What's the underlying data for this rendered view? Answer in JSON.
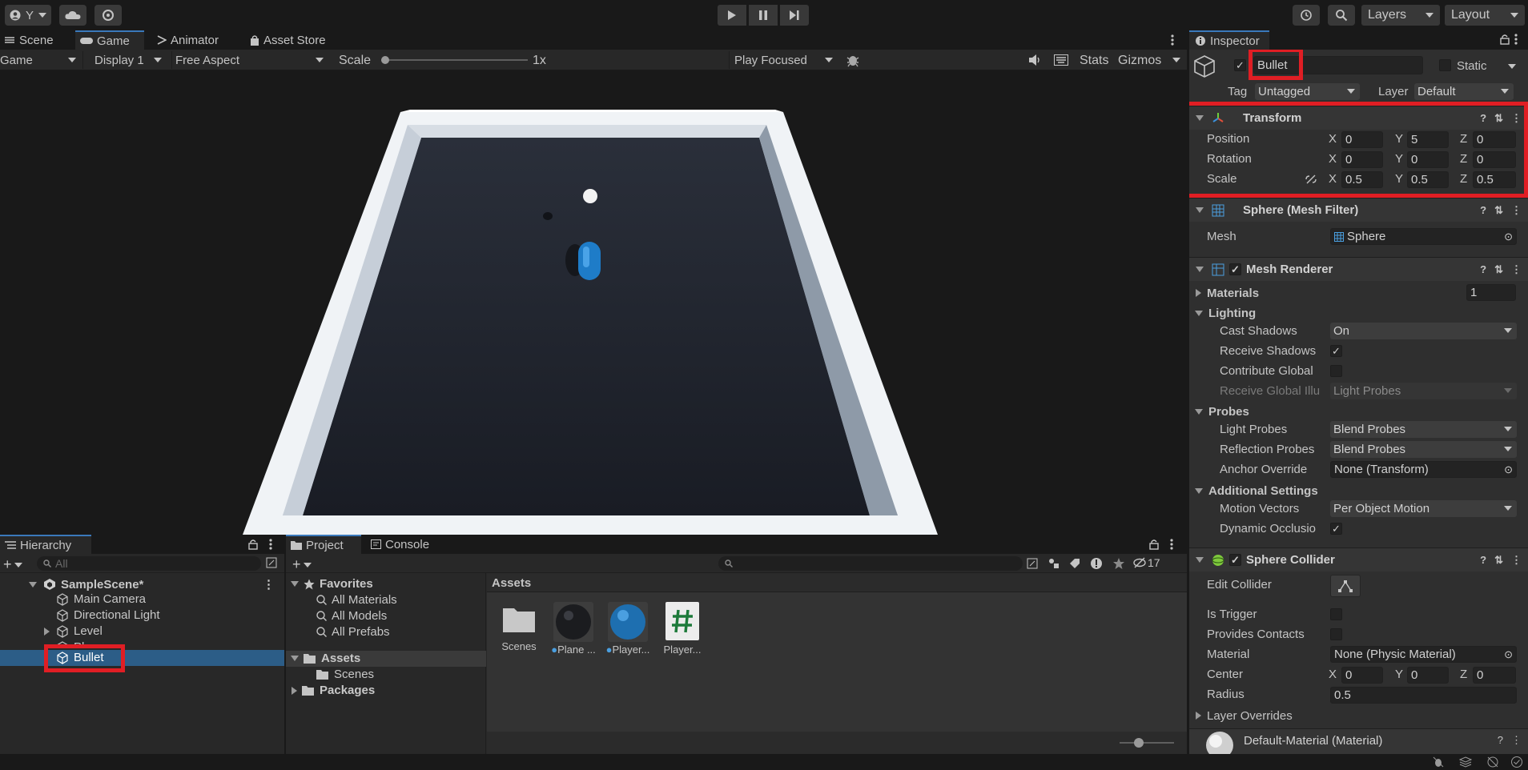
{
  "toolbar": {
    "account_label": "Y",
    "layers_label": "Layers",
    "layout_label": "Layout"
  },
  "tabs": {
    "scene": "Scene",
    "game": "Game",
    "animator": "Animator",
    "asset_store": "Asset Store",
    "inspector": "Inspector",
    "hierarchy": "Hierarchy",
    "project": "Project",
    "console": "Console"
  },
  "game_bar": {
    "mode": "Game",
    "display": "Display 1",
    "aspect": "Free Aspect",
    "scale_label": "Scale",
    "scale_value": "1x",
    "play_focused": "Play Focused",
    "stats": "Stats",
    "gizmos": "Gizmos"
  },
  "inspector": {
    "object_name": "Bullet",
    "static_label": "Static",
    "tag_label": "Tag",
    "tag_value": "Untagged",
    "layer_label": "Layer",
    "layer_value": "Default",
    "transform": {
      "title": "Transform",
      "position_label": "Position",
      "rotation_label": "Rotation",
      "scale_label": "Scale",
      "position": {
        "x": "0",
        "y": "5",
        "z": "0"
      },
      "rotation": {
        "x": "0",
        "y": "0",
        "z": "0"
      },
      "scale": {
        "x": "0.5",
        "y": "0.5",
        "z": "0.5"
      }
    },
    "mesh_filter": {
      "title": "Sphere (Mesh Filter)",
      "mesh_label": "Mesh",
      "mesh_value": "Sphere"
    },
    "mesh_renderer": {
      "title": "Mesh Renderer",
      "materials_label": "Materials",
      "materials_count": "1",
      "lighting_label": "Lighting",
      "cast_shadows_label": "Cast Shadows",
      "cast_shadows_value": "On",
      "receive_shadows_label": "Receive Shadows",
      "contribute_global_label": "Contribute Global",
      "receive_global_label": "Receive Global Illu",
      "receive_global_value": "Light Probes",
      "probes_label": "Probes",
      "light_probes_label": "Light Probes",
      "light_probes_value": "Blend Probes",
      "reflection_probes_label": "Reflection Probes",
      "reflection_probes_value": "Blend Probes",
      "anchor_override_label": "Anchor Override",
      "anchor_override_value": "None (Transform)",
      "additional_settings_label": "Additional Settings",
      "motion_vectors_label": "Motion Vectors",
      "motion_vectors_value": "Per Object Motion",
      "dynamic_occlusion_label": "Dynamic Occlusio"
    },
    "sphere_collider": {
      "title": "Sphere Collider",
      "edit_collider_label": "Edit Collider",
      "is_trigger_label": "Is Trigger",
      "provides_contacts_label": "Provides Contacts",
      "material_label": "Material",
      "material_value": "None (Physic Material)",
      "center_label": "Center",
      "center": {
        "x": "0",
        "y": "0",
        "z": "0"
      },
      "radius_label": "Radius",
      "radius_value": "0.5",
      "layer_overrides_label": "Layer Overrides"
    },
    "default_material": "Default-Material (Material)"
  },
  "hierarchy": {
    "search_placeholder": "All",
    "scene_name": "SampleScene*",
    "items": [
      {
        "label": "Main Camera"
      },
      {
        "label": "Directional Light"
      },
      {
        "label": "Level"
      },
      {
        "label": "Player"
      },
      {
        "label": "Bullet"
      }
    ]
  },
  "project": {
    "hidden_count": "17",
    "favorites_label": "Favorites",
    "favorites": [
      "All Materials",
      "All Models",
      "All Prefabs"
    ],
    "assets_label": "Assets",
    "scenes_folder": "Scenes",
    "packages_label": "Packages",
    "breadcrumb": "Assets",
    "assets": [
      {
        "label": "Scenes"
      },
      {
        "label": "Plane ..."
      },
      {
        "label": "Player..."
      },
      {
        "label": "Player..."
      }
    ]
  }
}
